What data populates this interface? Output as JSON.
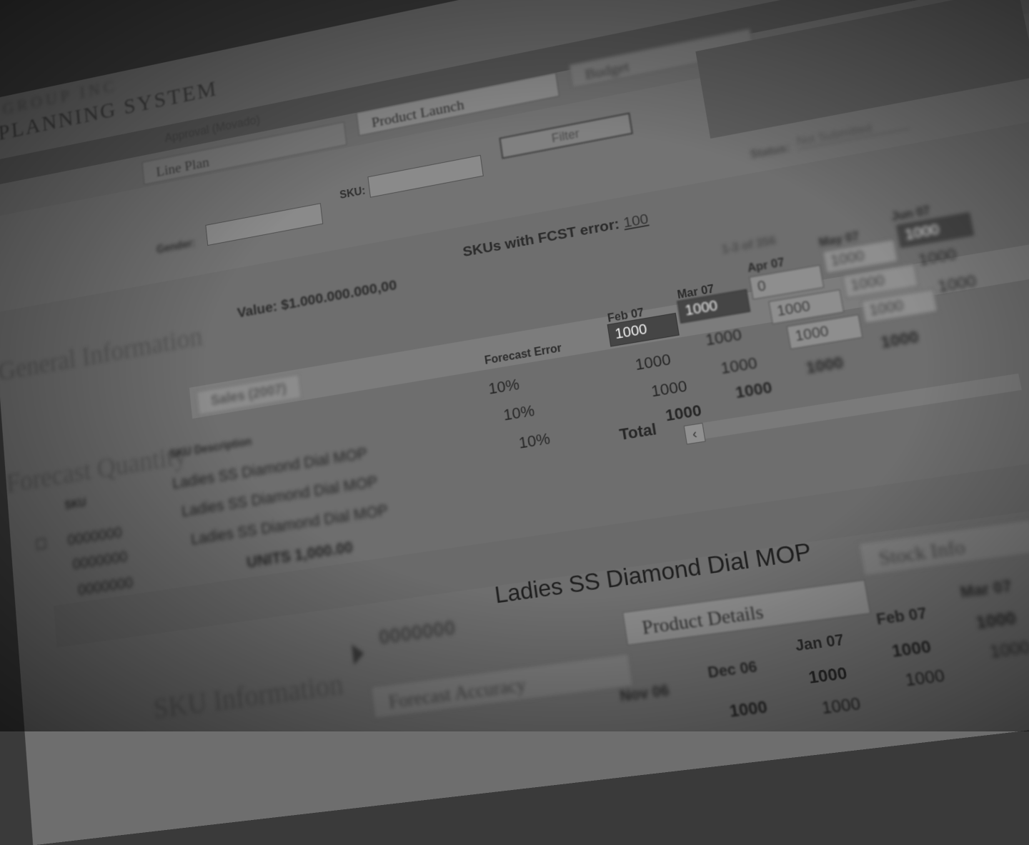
{
  "header": {
    "company": "GROUP INC",
    "system_title": "PLANNING SYSTEM"
  },
  "nav": {
    "left_link": "Approval (Movado)",
    "items": [
      "Line Plan",
      "Product Launch",
      "Budget"
    ]
  },
  "filters": {
    "gender_label": "Gender:",
    "gender_value": "",
    "sku_label": "SKU:",
    "sku_value": "",
    "filter_button": "Filter",
    "status_label": "Status:",
    "status_value": "Not Submitted"
  },
  "summary": {
    "section_title": "General Information",
    "value_text": "Value: $1.000.000.000,00",
    "fcst_error_label": "SKUs with FCST error:",
    "fcst_error_count": "100",
    "pager_text": "1-3 of 356"
  },
  "forecast": {
    "section_title": "Forecast Quantity",
    "tab_label": "Sales (2007)",
    "headers": {
      "sku": "SKU",
      "description": "SKU Description",
      "forecast_error": "Forecast Error"
    },
    "months": [
      "Feb 07",
      "Mar 07",
      "Apr 07",
      "May 07",
      "Jun 07"
    ],
    "rows": [
      {
        "sku": "0000000",
        "description": "Ladies SS Diamond Dial MOP",
        "error": "10%",
        "values": [
          "1000",
          "1000",
          "0",
          "1000",
          "1000"
        ]
      },
      {
        "sku": "0000000",
        "description": "Ladies SS Diamond Dial MOP",
        "error": "10%",
        "values": [
          "1000",
          "1000",
          "1000",
          "1000",
          "1000"
        ]
      },
      {
        "sku": "0000000",
        "description": "Ladies SS Diamond Dial MOP",
        "error": "10%",
        "values": [
          "1000",
          "1000",
          "1000",
          "1000",
          "1000"
        ]
      }
    ],
    "total_label": "Total",
    "totals": [
      "1000",
      "1000",
      "1000",
      "1000"
    ],
    "footer_text": "UNITS 1,000.00"
  },
  "detail": {
    "section_title": "SKU Information",
    "sku": "0000000",
    "title": "Ladies SS Diamond Dial MOP",
    "tabs": [
      "Forecast Accuracy",
      "Product Details",
      "Stock Info"
    ],
    "months": [
      "Nov 06",
      "Dec 06",
      "Jan 07",
      "Feb 07",
      "Mar 07"
    ],
    "row1": [
      "1000",
      "1000",
      "1000",
      "1000"
    ],
    "row2": [
      "1000",
      "1000",
      "1000",
      "1000"
    ]
  }
}
